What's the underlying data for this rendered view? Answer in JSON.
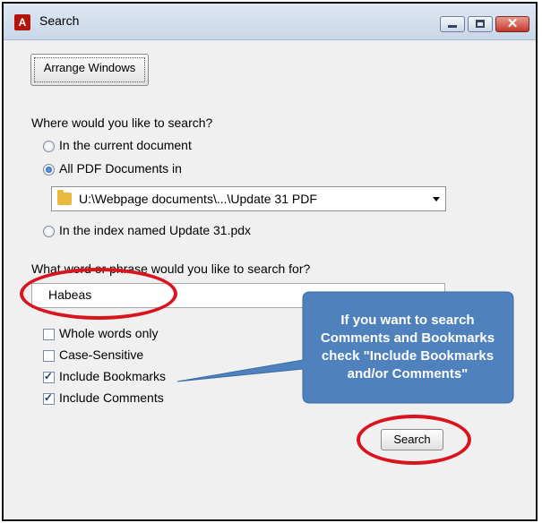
{
  "window": {
    "title": "Search",
    "app_icon": "acrobat-icon",
    "controls": [
      "minimize-icon",
      "maximize-icon",
      "close-icon"
    ]
  },
  "arrange_button": "Arrange Windows",
  "where": {
    "label": "Where would you like to search?",
    "options": [
      {
        "label": "In the current document",
        "selected": false
      },
      {
        "label": "All PDF Documents in",
        "selected": true
      },
      {
        "label": "In the index named Update 31.pdx",
        "selected": false
      }
    ],
    "folder_path": "U:\\Webpage documents\\...\\Update 31 PDF"
  },
  "query": {
    "label": "What word or phrase would you like to search for?",
    "value": "Habeas"
  },
  "options": [
    {
      "label": "Whole words only",
      "checked": false
    },
    {
      "label": "Case-Sensitive",
      "checked": false
    },
    {
      "label": "Include Bookmarks",
      "checked": true
    },
    {
      "label": "Include Comments",
      "checked": true
    }
  ],
  "search_button": "Search",
  "callout": {
    "text": "If you want to search Comments and Bookmarks check \"Include Bookmarks and/or Comments\""
  },
  "colors": {
    "callout_fill": "#4f81bd",
    "highlight_oval": "#d9141c"
  }
}
